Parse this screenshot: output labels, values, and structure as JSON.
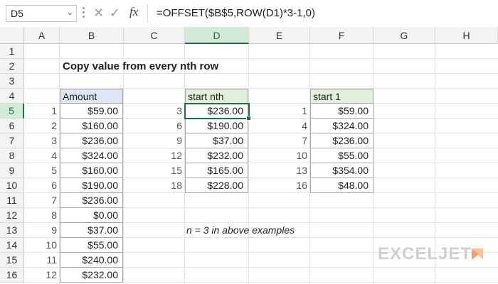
{
  "formula_bar": {
    "name_box": "D5",
    "formula": "=OFFSET($B$5,ROW(D1)*3-1,0)"
  },
  "icons": {
    "cancel": "close-icon",
    "enter": "check-icon",
    "function": "fx-icon",
    "dropdown": "chevron-down-icon"
  },
  "columns": [
    "A",
    "B",
    "C",
    "D",
    "E",
    "F",
    "G",
    "H"
  ],
  "rows": [
    "1",
    "2",
    "3",
    "4",
    "5",
    "6",
    "7",
    "8",
    "9",
    "10",
    "11",
    "12",
    "13",
    "14",
    "15",
    "16"
  ],
  "selected_cell": {
    "column": "D",
    "row": "5"
  },
  "sheet": {
    "title": "Copy value from every nth row",
    "amount": {
      "header": "Amount",
      "index": [
        "1",
        "2",
        "3",
        "4",
        "5",
        "6",
        "7",
        "8",
        "9",
        "10",
        "11",
        "12"
      ],
      "values": [
        "$59.00",
        "$160.00",
        "$236.00",
        "$324.00",
        "$160.00",
        "$190.00",
        "$236.00",
        "$0.00",
        "$37.00",
        "$55.00",
        "$240.00",
        "$232.00"
      ]
    },
    "start_nth": {
      "header": "start nth",
      "index": [
        "3",
        "6",
        "9",
        "12",
        "15",
        "18"
      ],
      "values": [
        "$236.00",
        "$190.00",
        "$37.00",
        "$232.00",
        "$165.00",
        "$228.00"
      ]
    },
    "start_1": {
      "header": "start 1",
      "index": [
        "1",
        "4",
        "7",
        "10",
        "13",
        "16"
      ],
      "values": [
        "$59.00",
        "$324.00",
        "$236.00",
        "$55.00",
        "$354.00",
        "$48.00"
      ]
    },
    "note": "n = 3 in above examples"
  },
  "brand": {
    "logo_text": "EXCELJET"
  },
  "colors": {
    "selection": "#1e7145",
    "header_blue": "#dde6f5",
    "header_green": "#e2efda"
  }
}
